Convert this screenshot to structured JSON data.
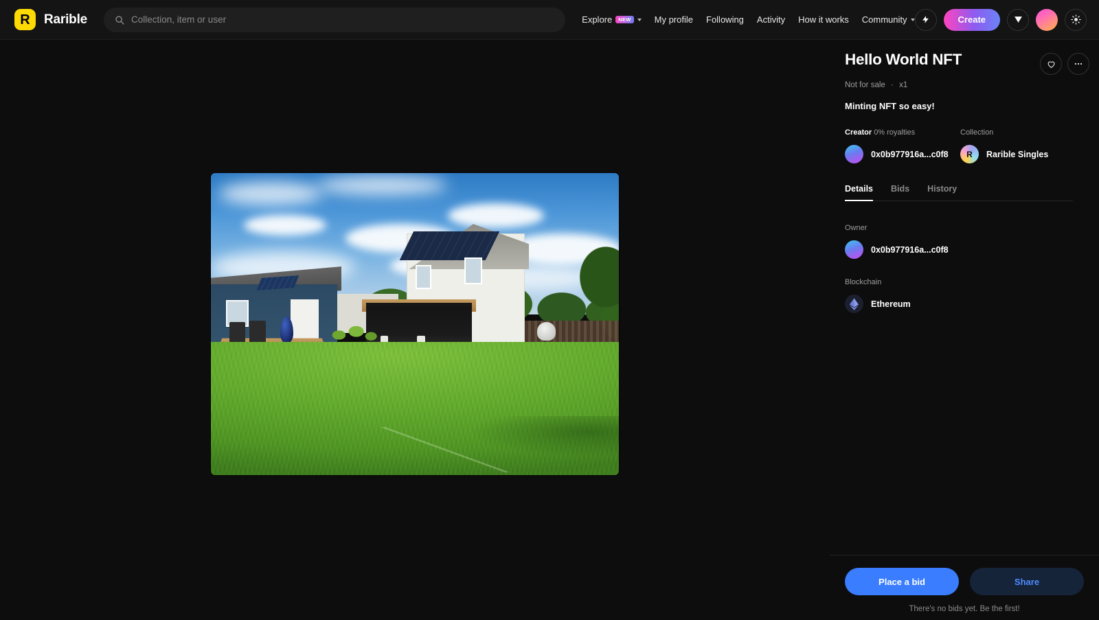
{
  "header": {
    "brand": "Rarible",
    "logo_letter": "R",
    "logo_color": "#FEDA03",
    "search": {
      "placeholder": "Collection, item or user",
      "value": ""
    },
    "nav": [
      {
        "label": "Explore",
        "badge": "NEW",
        "has_chevron": true
      },
      {
        "label": "My profile",
        "badge": "",
        "has_chevron": false
      },
      {
        "label": "Following",
        "badge": "",
        "has_chevron": false
      },
      {
        "label": "Activity",
        "badge": "",
        "has_chevron": false
      },
      {
        "label": "How it works",
        "badge": "",
        "has_chevron": false
      },
      {
        "label": "Community",
        "badge": "",
        "has_chevron": true
      }
    ],
    "create_label": "Create",
    "icons": {
      "lightning": "lightning-icon",
      "send": "send-icon",
      "avatar": "user-avatar",
      "theme": "sun-icon"
    },
    "accent_gradient": "#FE44C0"
  },
  "item": {
    "title": "Hello World NFT",
    "sale_status": "Not for sale",
    "separator": "·",
    "quantity": "x1",
    "description": "Minting NFT so easy!",
    "like_icon": "heart-icon",
    "more_icon": "more-options-icon"
  },
  "creator": {
    "label": "Creator",
    "royalties": "0% royalties",
    "address": "0x0b977916a...c0f8"
  },
  "collection": {
    "label": "Collection",
    "name": "Rarible Singles",
    "badge_letter": "R"
  },
  "tabs": [
    {
      "label": "Details",
      "active": true
    },
    {
      "label": "Bids",
      "active": false
    },
    {
      "label": "History",
      "active": false
    }
  ],
  "details": {
    "owner_label": "Owner",
    "owner_address": "0x0b977916a...c0f8",
    "blockchain_label": "Blockchain",
    "blockchain_name": "Ethereum"
  },
  "footer": {
    "place_bid_label": "Place a bid",
    "share_label": "Share",
    "bid_note": "There's no bids yet. Be the first!",
    "primary_color": "#3A7DFF"
  },
  "artwork": {
    "alt": "Backyard photo with green lawn, blue shed with solar panels, and white two-story house with screened porch"
  }
}
